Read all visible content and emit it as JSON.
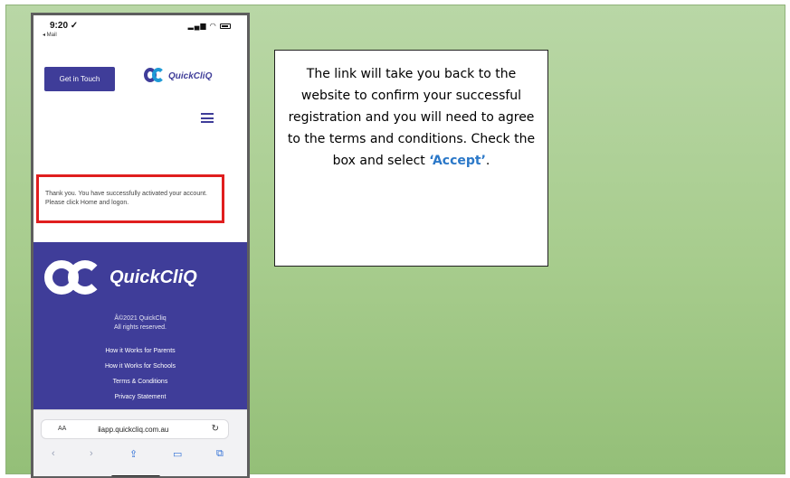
{
  "colors": {
    "brand_purple": "#3f3d99",
    "brand_blue": "#1f9ad6",
    "highlight_red": "#e01e1e",
    "accept_blue": "#2b78c8",
    "slide_green": "#a7cc8d"
  },
  "phone": {
    "status": {
      "time": "9:20 ✓",
      "back_label": "◂ Mail"
    },
    "header": {
      "get_in_touch": "Get in Touch",
      "logo_text": "QuickCliQ",
      "menu_icon": "hamburger-icon"
    },
    "message": "Thank you. You have successfully activated your account. Please click Home and logon.",
    "footer": {
      "logo_text": "QuickCliQ",
      "copyright_line1": "Â©2021 QuickCliq",
      "copyright_line2": "All rights reserved.",
      "links": [
        "How it Works for Parents",
        "How it Works for Schools",
        "Terms & Conditions",
        "Privacy Statement"
      ]
    },
    "browser": {
      "text_size_label": "AA",
      "url": "app.quickcliq.com.au",
      "icons": [
        "back-icon",
        "forward-icon",
        "share-icon",
        "bookmarks-icon",
        "tabs-icon"
      ]
    }
  },
  "callout": {
    "text_main": "The link will take you back to the website to confirm your successful registration and you will need to agree to the terms and conditions. Check the box and select ",
    "accept_text": "‘Accept’",
    "text_end": "."
  }
}
